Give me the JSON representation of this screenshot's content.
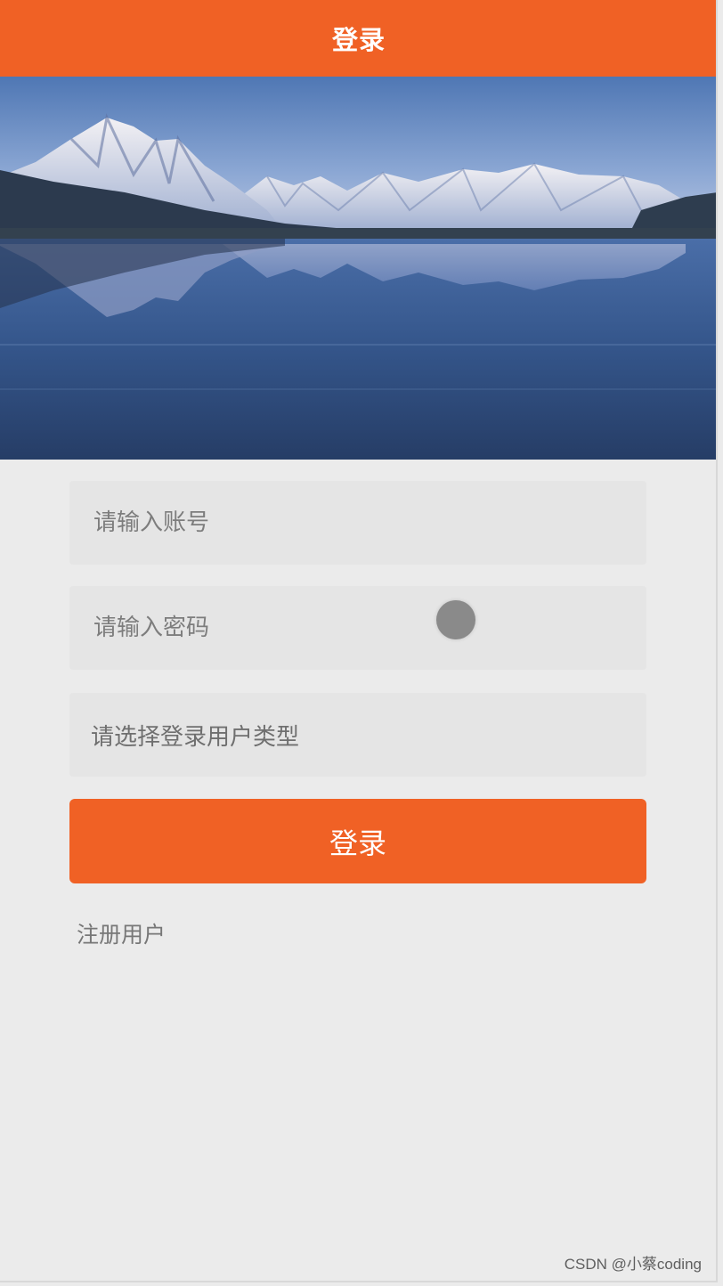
{
  "header": {
    "title": "登录"
  },
  "form": {
    "account_placeholder": "请输入账号",
    "password_placeholder": "请输入密码",
    "user_type_placeholder": "请选择登录用户类型",
    "login_label": "登录",
    "register_label": "注册用户"
  },
  "watermark": "CSDN @小蔡coding",
  "colors": {
    "accent": "#f06125",
    "background": "#ebebeb",
    "field_background": "#e5e5e5",
    "placeholder_text": "#7d7d7d"
  }
}
